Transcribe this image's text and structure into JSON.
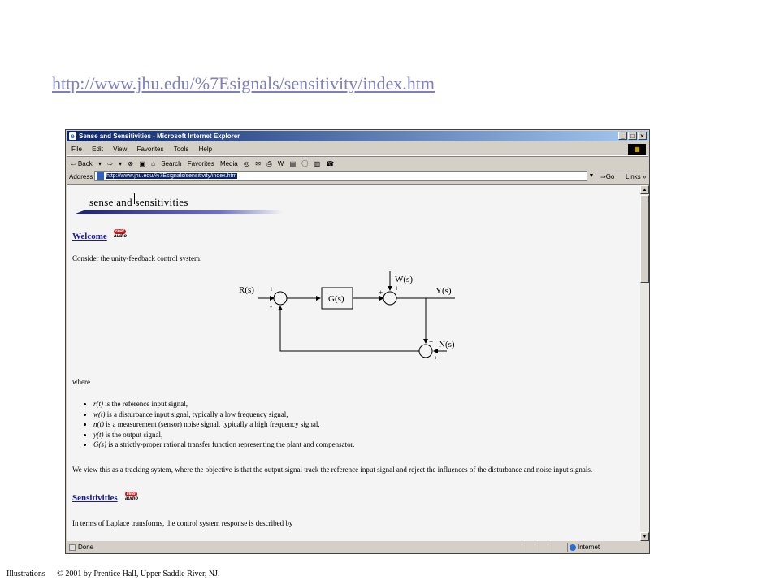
{
  "slide": {
    "url_link": "http://www.jhu.edu/%7Esignals/sensitivity/index.htm",
    "footer_label": "Illustrations",
    "footer_copyright": "© 2001 by Prentice Hall, Upper Saddle River, NJ."
  },
  "window": {
    "title": "Sense and Sensitivities - Microsoft Internet Explorer",
    "controls": [
      "_",
      "□",
      "×"
    ],
    "menu": [
      "File",
      "Edit",
      "View",
      "Favorites",
      "Tools",
      "Help"
    ],
    "toolbar": [
      "⇦ Back",
      "▾",
      "⇨",
      "▾",
      "⊗",
      "▣",
      "⌂",
      "Search",
      "Favorites",
      "Media",
      "◎",
      "✉",
      "⎙",
      "W",
      "▤",
      "ⓘ",
      "▥",
      "☎"
    ],
    "address_label": "Address",
    "address_url": "http://www.jhu.edu/%7Esignals/sensitivity/index.htm",
    "go_label": "⇒Go",
    "links_label": "Links »",
    "status_text": "Done",
    "zone_text": "Internet"
  },
  "page": {
    "banner_title": "sense and sensitivities",
    "welcome_link": "Welcome",
    "real_audio_top": "real",
    "real_audio_bottom": "audio",
    "intro": "Consider the unity-feedback control system:",
    "diagram": {
      "r": "R(s)",
      "g": "G(s)",
      "w": "W(s)",
      "y": "Y(s)",
      "n": "N(s)",
      "plus": "+",
      "minus": "-",
      "i": "i"
    },
    "where": "where",
    "bullets": [
      {
        "sym": "r(t)",
        "text": " is the reference input signal,"
      },
      {
        "sym": "w(t)",
        "text": " is a disturbance input signal, typically a low frequency signal,"
      },
      {
        "sym": "n(t)",
        "text": " is a measurement (sensor) noise signal, typically a high frequency signal,"
      },
      {
        "sym": "y(t)",
        "text": " is the output signal,"
      },
      {
        "sym": "G(s)",
        "text": " is a strictly-proper rational transfer function representing the plant and compensator."
      }
    ],
    "tracking": "We view this as a tracking system, where the objective is that the output signal track the reference input signal and reject the influences of the disturbance and noise input signals.",
    "sensitivities_link": "Sensitivities",
    "laplace": "In terms of Laplace transforms, the control system response is described by"
  }
}
